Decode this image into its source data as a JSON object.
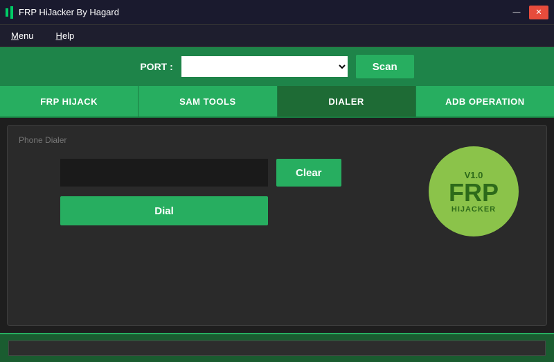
{
  "titleBar": {
    "title": "FRP HiJacker By Hagard",
    "minimizeLabel": "—",
    "closeLabel": "✕"
  },
  "menuBar": {
    "items": [
      {
        "id": "menu",
        "label": "Menu",
        "underlineIndex": 0
      },
      {
        "id": "help",
        "label": "Help",
        "underlineIndex": 0
      }
    ]
  },
  "portBar": {
    "portLabel": "PORT :",
    "scanLabel": "Scan"
  },
  "tabs": [
    {
      "id": "frp-hijack",
      "label": "FRP HIJACK",
      "active": false
    },
    {
      "id": "sam-tools",
      "label": "SAM TOOLS",
      "active": false
    },
    {
      "id": "dialer",
      "label": "DIALER",
      "active": true
    },
    {
      "id": "adb-operation",
      "label": "ADB OPERATION",
      "active": false
    }
  ],
  "dialerPanel": {
    "sectionLabel": "Phone Dialer",
    "clearLabel": "Clear",
    "dialLabel": "Dial",
    "inputPlaceholder": ""
  },
  "frpLogo": {
    "version": "V1.0",
    "mainText": "FRP",
    "subText": "HIJACKER"
  },
  "colors": {
    "green": "#27ae60",
    "darkGreen": "#1a5c30",
    "logoGreen": "#8bc34a",
    "logoText": "#2d6a1a"
  }
}
